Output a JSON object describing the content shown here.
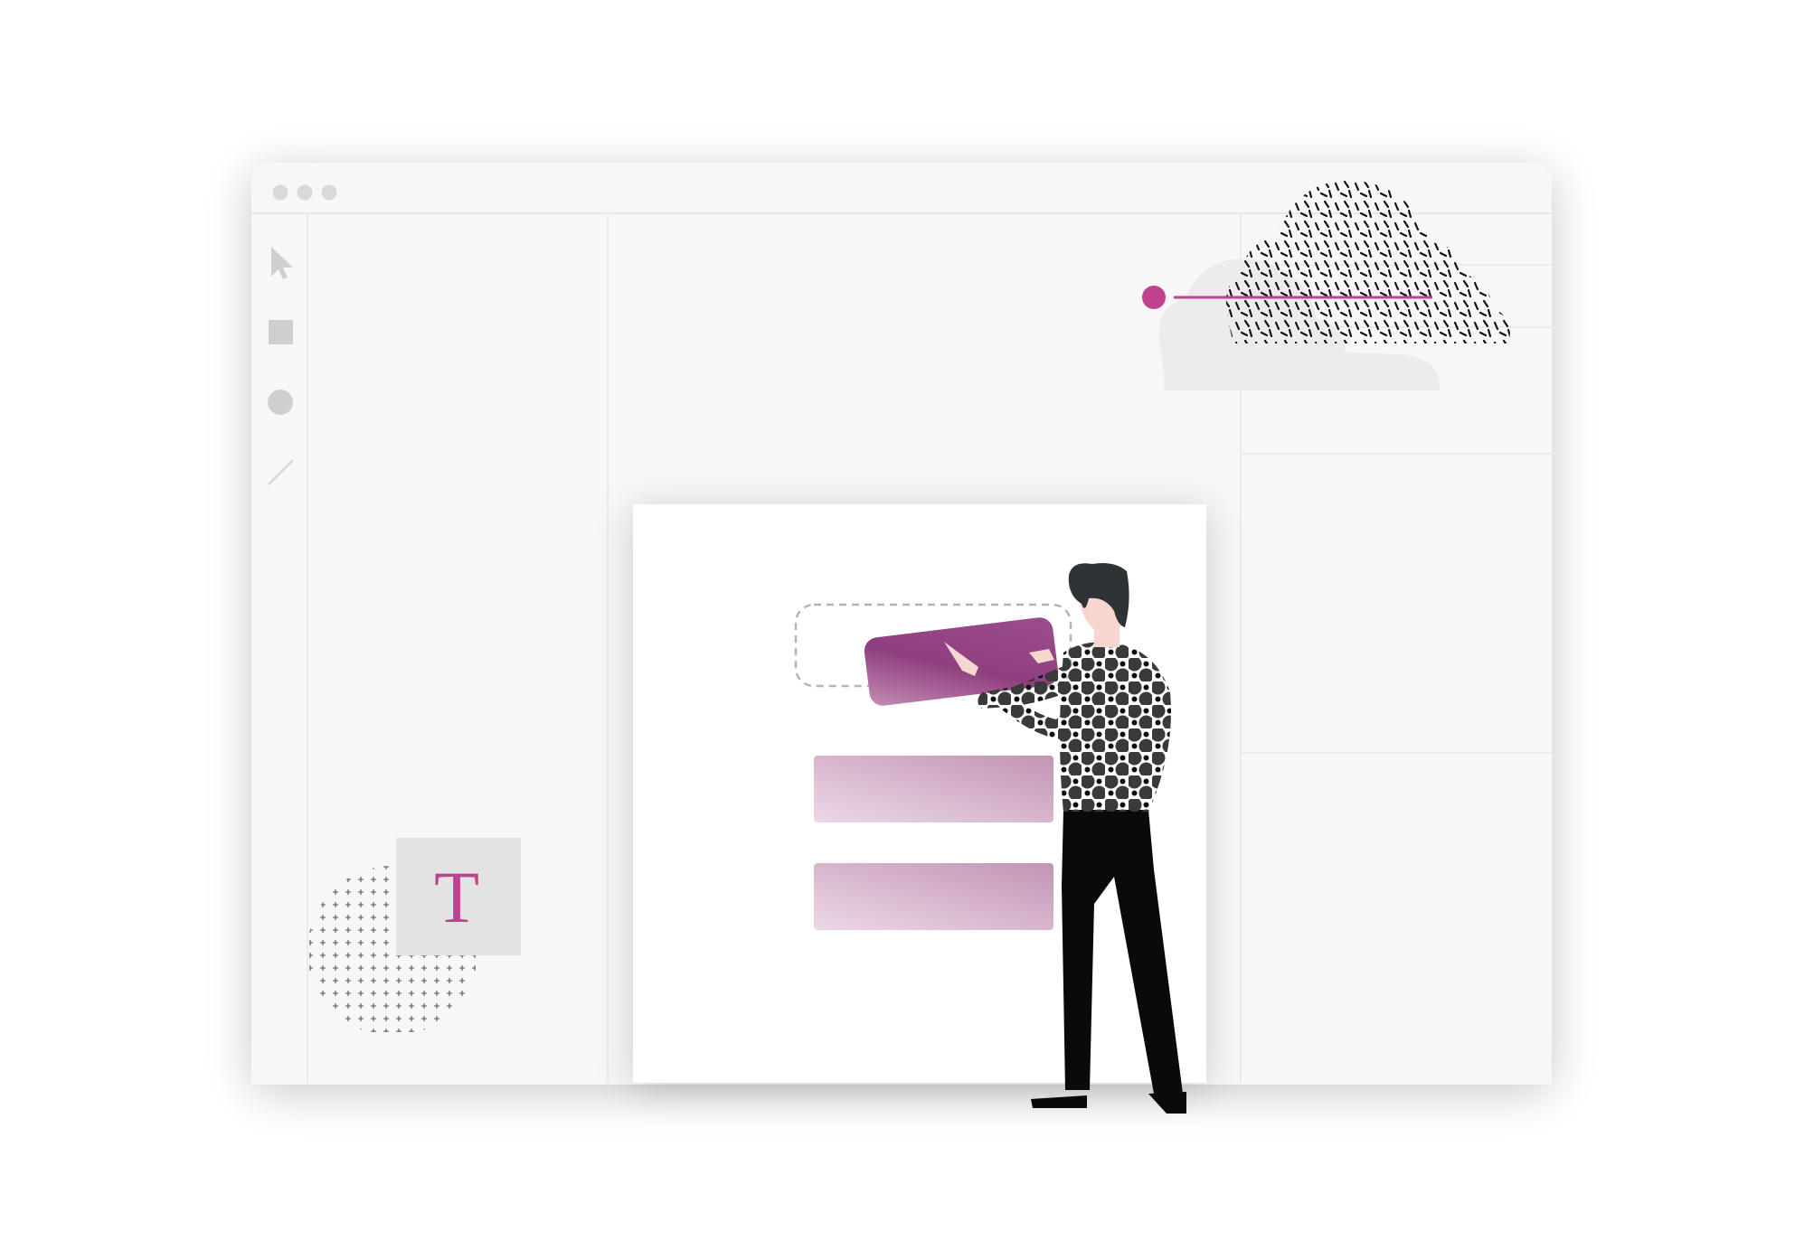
{
  "window": {
    "controls": [
      "window-dot-1",
      "window-dot-2",
      "window-dot-3"
    ]
  },
  "toolbar": {
    "tools": [
      {
        "id": "select",
        "icon": "pointer-arrow-icon"
      },
      {
        "id": "rectangle",
        "icon": "square-icon"
      },
      {
        "id": "ellipse",
        "icon": "circle-icon"
      },
      {
        "id": "line",
        "icon": "line-icon"
      }
    ]
  },
  "canvas": {
    "text_tool_glyph": "T",
    "artboard": {
      "components": [
        {
          "id": "dragged-component",
          "state": "dragging"
        },
        {
          "id": "component-bar-1",
          "state": "placed"
        },
        {
          "id": "component-bar-2",
          "state": "placed"
        }
      ]
    }
  },
  "decor": {
    "cloud_icon": "cloud-icon",
    "connector": "connector-line"
  },
  "colors": {
    "window_bg": "#f7f7f7",
    "divider": "#e8e8e8",
    "tool_icon": "#cfcfcf",
    "accent": "#c0418f",
    "component_dark": "#8e3d7e",
    "component_light": "#c69ab8",
    "figure_dark": "#0d0d0d",
    "skin": "#f6d6cf"
  }
}
